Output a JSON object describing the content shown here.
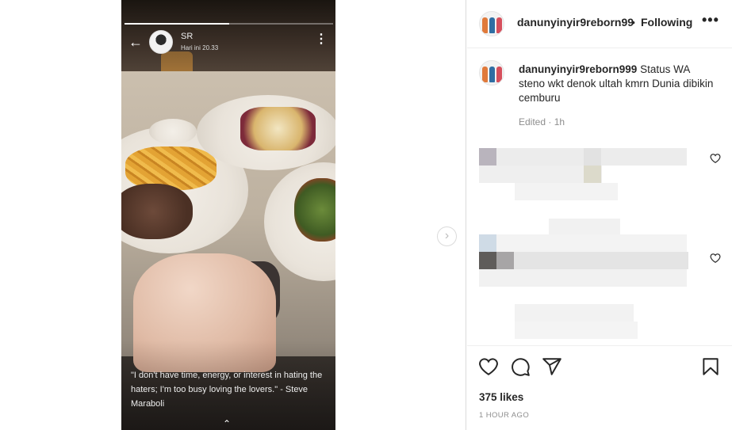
{
  "story": {
    "name": "SR",
    "time": "Hari ini 20.33",
    "progress": 0.5,
    "caption": "\"I don't have time, energy, or interest in hating the haters; I'm too busy loving the lovers.\" - Steve Maraboli"
  },
  "post": {
    "username": "danunyinyir9reborn99",
    "separator": "•",
    "follow_status": "Following",
    "caption_user": "danunyinyir9reborn999",
    "caption_text": "Status WA steno wkt denok ultah kmrn Dunia dibikin cemburu",
    "edited": "Edited · 1h"
  },
  "engagement": {
    "likes": "375 likes",
    "time_ago": "1 HOUR AGO"
  },
  "icons": {
    "back": "arrow-left-icon",
    "menu": "vertical-ellipsis-icon",
    "next": "chevron-right-icon",
    "more": "horizontal-ellipsis-icon",
    "like": "heart-outline-icon",
    "comment": "comment-bubble-icon",
    "share": "paper-plane-icon",
    "save": "bookmark-icon"
  },
  "colors": {
    "text": "#262626",
    "muted": "#8e8e8e",
    "border": "#dbdbdb"
  }
}
